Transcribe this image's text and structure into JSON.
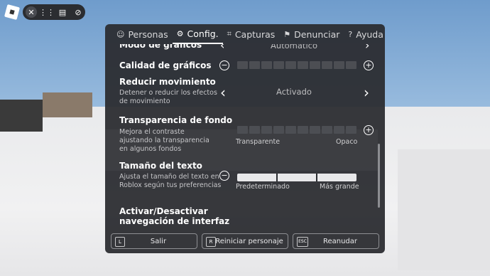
{
  "topbar": {
    "icons": [
      "roblox-logo",
      "close-icon",
      "menu-grid-icon",
      "chat-icon",
      "mic-muted-icon"
    ]
  },
  "tabs": [
    {
      "icon": "people-icon",
      "label": "Personas"
    },
    {
      "icon": "gear-icon",
      "label": "Config.",
      "active": true
    },
    {
      "icon": "camera-icon",
      "label": "Capturas"
    },
    {
      "icon": "flag-icon",
      "label": "Denunciar"
    },
    {
      "icon": "help-icon",
      "label": "Ayuda"
    }
  ],
  "settings": {
    "graphics_mode": {
      "label": "Modo de gráficos",
      "value": "Automático"
    },
    "graphics_quality": {
      "label": "Calidad de gráficos",
      "level": 0
    },
    "reduce_motion": {
      "label": "Reducir movimiento",
      "description": "Detener o reducir los efectos de movimiento",
      "value": "Activado"
    },
    "background_transparency": {
      "label": "Transparencia de fondo",
      "description": "Mejora el contraste ajustando la transparencia en algunos fondos",
      "min_label": "Transparente",
      "max_label": "Opaco",
      "level": 0
    },
    "text_size": {
      "label": "Tamaño del texto",
      "description": "Ajusta el tamaño del texto en Roblox según tus preferencias",
      "min_label": "Predeterminado",
      "max_label": "Más grande",
      "level": 0
    },
    "ui_navigation": {
      "label": "Activar/Desactivar navegación de interfaz"
    }
  },
  "bottom": {
    "leave": {
      "key": "L",
      "label": "Salir"
    },
    "reset": {
      "key": "R",
      "label": "Reiniciar personaje"
    },
    "resume": {
      "key": "ESC",
      "label": "Reanudar"
    }
  }
}
